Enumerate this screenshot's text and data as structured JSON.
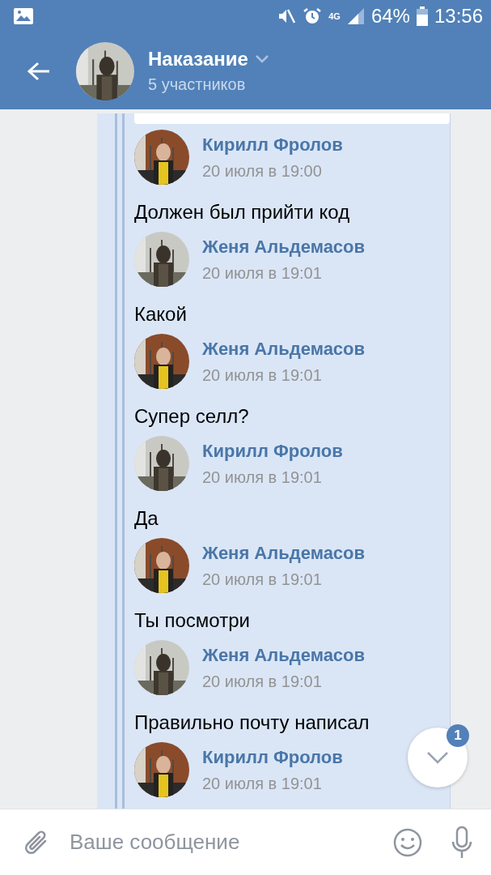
{
  "status_bar": {
    "network": "4G",
    "battery": "64%",
    "time": "13:56"
  },
  "header": {
    "title": "Наказание",
    "subtitle": "5 участников"
  },
  "messages": [
    {
      "author": "Кирилл Фролов",
      "date": "20 июля в 19:00",
      "text": "Должен был прийти код"
    },
    {
      "author": "Женя Альдемасов",
      "date": "20 июля в 19:01",
      "text": "Какой"
    },
    {
      "author": "Женя Альдемасов",
      "date": "20 июля в 19:01",
      "text": "Супер селл?"
    },
    {
      "author": "Кирилл Фролов",
      "date": "20 июля в 19:01",
      "text": "Да"
    },
    {
      "author": "Женя Альдемасов",
      "date": "20 июля в 19:01",
      "text": "Ты посмотри"
    },
    {
      "author": "Женя Альдемасов",
      "date": "20 июля в 19:01",
      "text": "Правильно почту написал"
    },
    {
      "author": "Кирилл Фролов",
      "date": "20 июля в 19:01"
    }
  ],
  "scroll_button": {
    "badge": "1"
  },
  "composer": {
    "placeholder": "Ваше сообщение"
  }
}
